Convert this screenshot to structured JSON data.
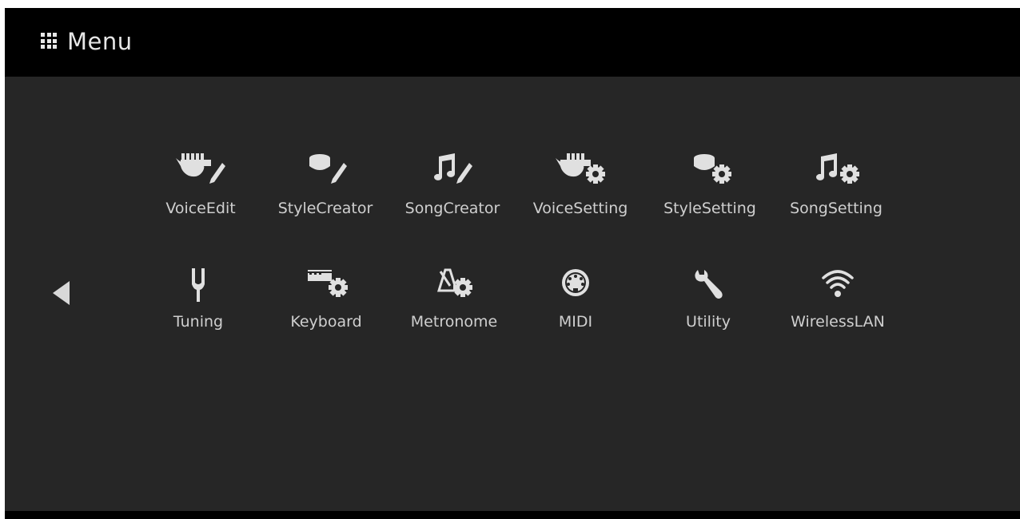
{
  "header": {
    "title": "Menu",
    "icon": "grid-icon"
  },
  "navigation": {
    "prev_icon": "left-arrow-icon"
  },
  "menu": {
    "items": [
      {
        "label": "VoiceEdit",
        "icon": "voice-edit-icon"
      },
      {
        "label": "StyleCreator",
        "icon": "style-creator-icon"
      },
      {
        "label": "SongCreator",
        "icon": "song-creator-icon"
      },
      {
        "label": "VoiceSetting",
        "icon": "voice-setting-icon"
      },
      {
        "label": "StyleSetting",
        "icon": "style-setting-icon"
      },
      {
        "label": "SongSetting",
        "icon": "song-setting-icon"
      },
      {
        "label": "Tuning",
        "icon": "tuning-fork-icon"
      },
      {
        "label": "Keyboard",
        "icon": "keyboard-setting-icon"
      },
      {
        "label": "Metronome",
        "icon": "metronome-setting-icon"
      },
      {
        "label": "MIDI",
        "icon": "midi-icon"
      },
      {
        "label": "Utility",
        "icon": "wrench-icon"
      },
      {
        "label": "WirelessLAN",
        "icon": "wifi-icon"
      }
    ]
  },
  "colors": {
    "background": "#262626",
    "header": "#000000",
    "text": "#cfcfcf",
    "icon": "#e0e0e0"
  }
}
